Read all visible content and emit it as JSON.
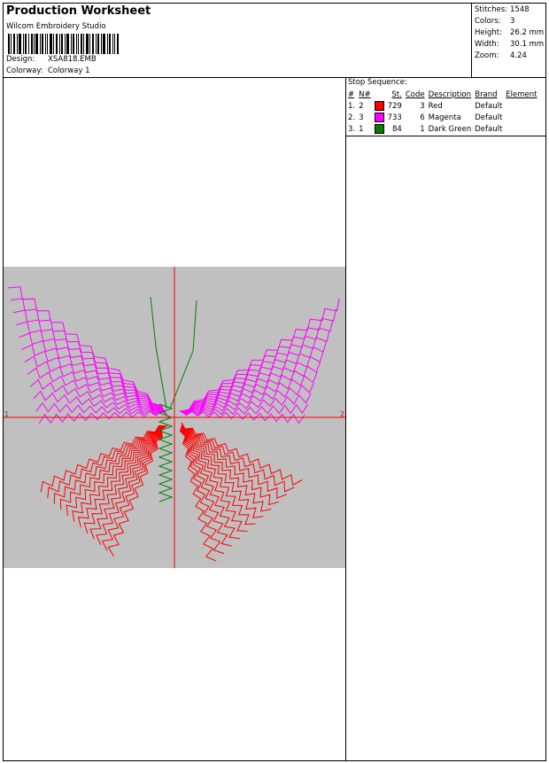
{
  "header": {
    "title": "Production Worksheet",
    "product": "Wilcom Embroidery Studio",
    "design_label": "Design:",
    "design_value": "XSA818.EMB",
    "colorway_label": "Colorway:",
    "colorway_value": "Colorway 1"
  },
  "stats": [
    {
      "label": "Stitches:",
      "value": "1548"
    },
    {
      "label": "Colors:",
      "value": "3"
    },
    {
      "label": "Height:",
      "value": "26.2 mm"
    },
    {
      "label": "Width:",
      "value": "30.1 mm"
    },
    {
      "label": "Zoom:",
      "value": "4.24"
    }
  ],
  "stop_sequence": {
    "title": "Stop Sequence:",
    "columns": [
      "#",
      "N#",
      "St.",
      "Code",
      "Description",
      "Brand",
      "Element"
    ],
    "rows": [
      {
        "num": "1.",
        "n": "2",
        "color": "#ff0000",
        "st": "729",
        "code": "3",
        "desc": "Red",
        "brand": "Default",
        "element": ""
      },
      {
        "num": "2.",
        "n": "3",
        "color": "#ff00ff",
        "st": "733",
        "code": "6",
        "desc": "Magenta",
        "brand": "Default",
        "element": ""
      },
      {
        "num": "3.",
        "n": "1",
        "color": "#008000",
        "st": "84",
        "code": "1",
        "desc": "Dark Green",
        "brand": "Default",
        "element": ""
      }
    ]
  },
  "design_preview": {
    "background": "#c0c0c0",
    "axis_color": "#ff0000",
    "axis_label_left": "1",
    "axis_label_right": "2",
    "colors": {
      "wing_upper": "#ff00ff",
      "wing_lower": "#ff0000",
      "body": "#008000"
    }
  }
}
